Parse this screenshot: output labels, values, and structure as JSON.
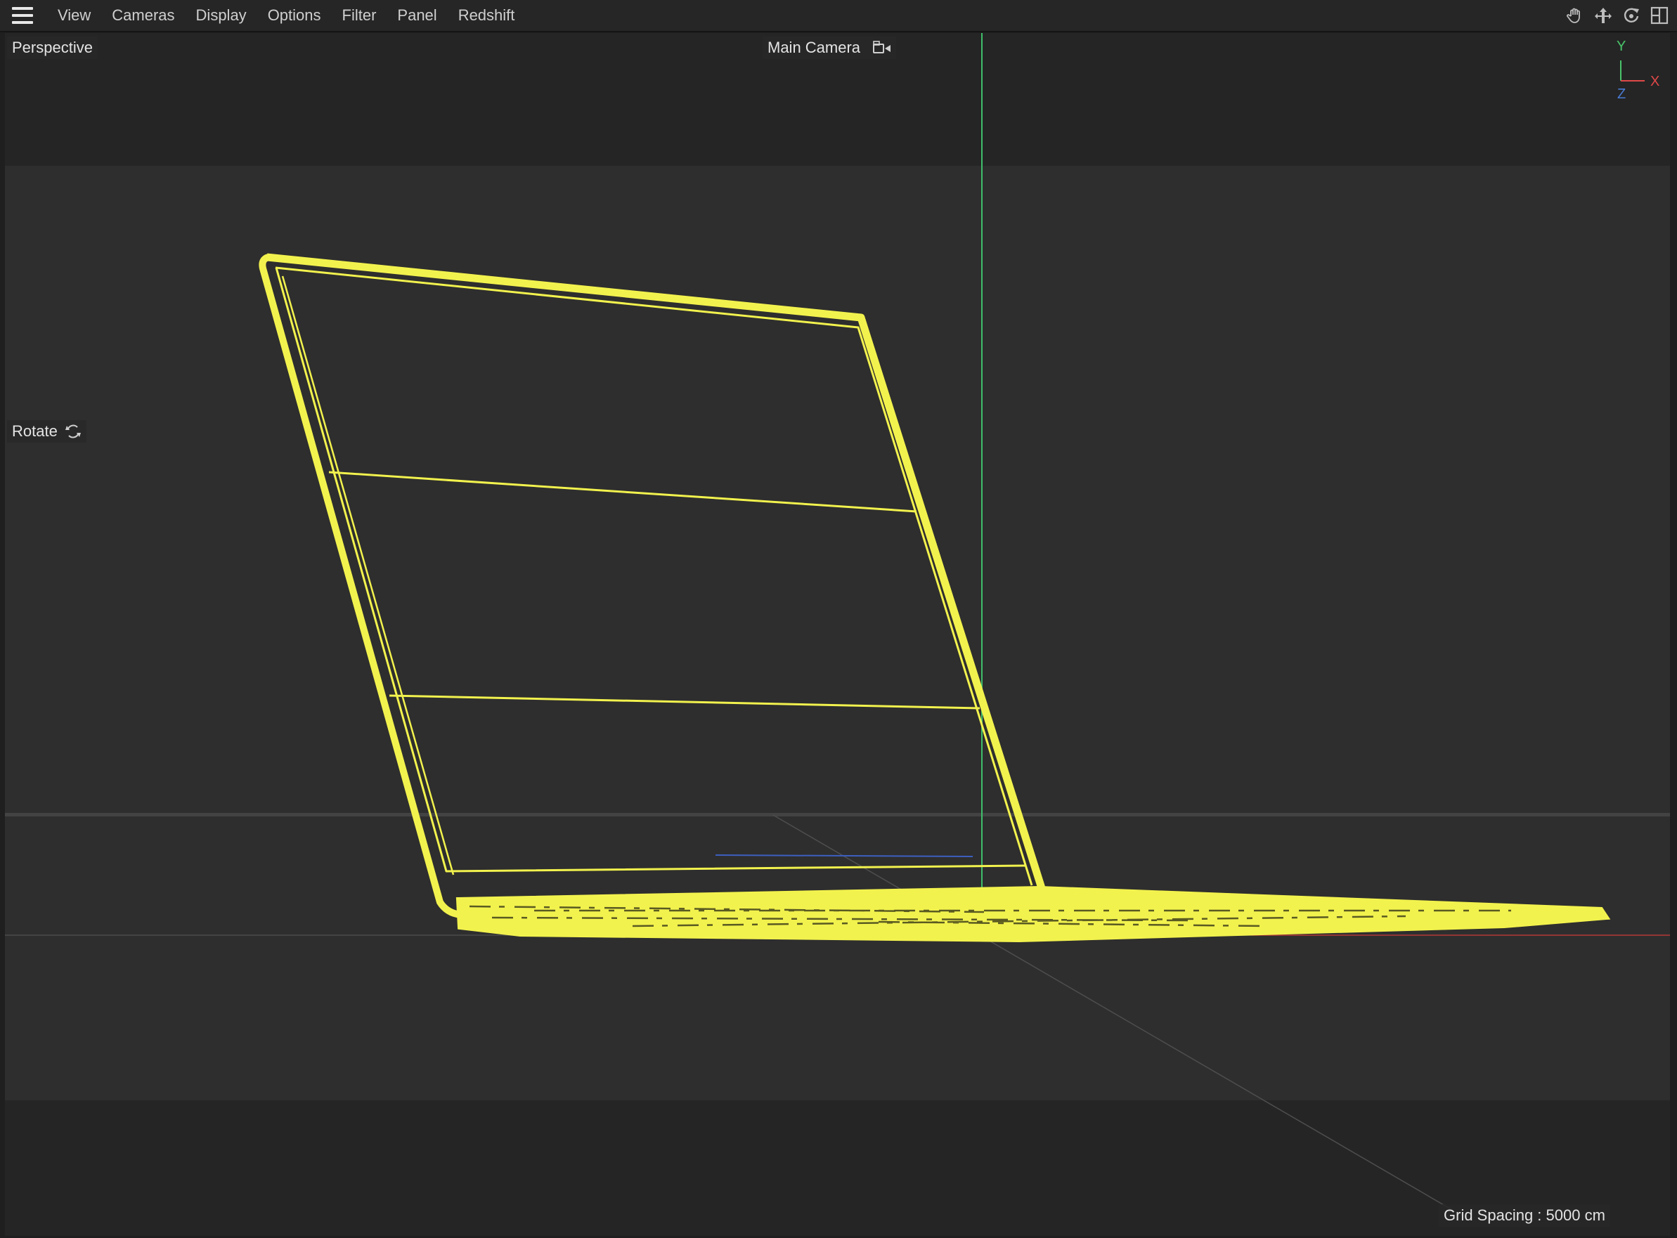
{
  "menubar": {
    "items": [
      {
        "name": "menu-view",
        "label": "View"
      },
      {
        "name": "menu-cameras",
        "label": "Cameras"
      },
      {
        "name": "menu-display",
        "label": "Display"
      },
      {
        "name": "menu-options",
        "label": "Options"
      },
      {
        "name": "menu-filter",
        "label": "Filter"
      },
      {
        "name": "menu-panel",
        "label": "Panel"
      },
      {
        "name": "menu-redshift",
        "label": "Redshift"
      }
    ],
    "tools": [
      "pan-hand-icon",
      "move-view-icon",
      "rotate-view-icon",
      "maximize-panel-icon"
    ]
  },
  "viewport": {
    "projection": "Perspective",
    "camera": "Main Camera",
    "camera_icon": "camera-toggle-icon",
    "tool_hint": "Rotate",
    "tool_hint_icon": "rotate-icon",
    "grid_spacing": "Grid Spacing : 5000 cm"
  },
  "axis_gizmo": {
    "y": "Y",
    "x": "X",
    "z": "Z",
    "colors": {
      "x": "#e04848",
      "y": "#49c46a",
      "z": "#4a7bd4"
    }
  },
  "colors": {
    "selection": "#f2f24e",
    "background": "#252525",
    "floor_band": "#2e2e2e"
  }
}
